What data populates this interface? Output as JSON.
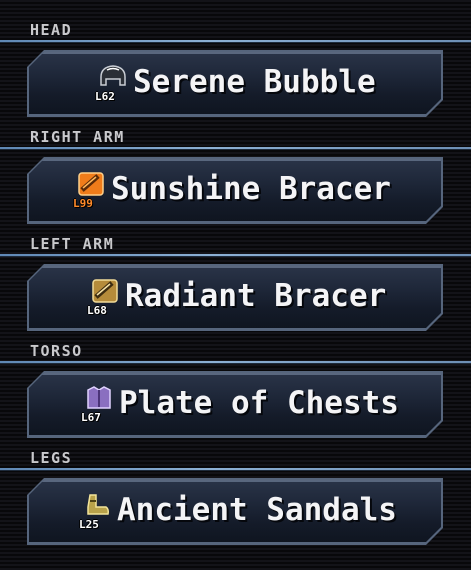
{
  "equipment": {
    "slots": [
      {
        "label": "HEAD",
        "item_name": "Serene Bubble",
        "level": "L62",
        "icon": "helmet-icon"
      },
      {
        "label": "RIGHT ARM",
        "item_name": "Sunshine Bracer",
        "level": "L99",
        "icon": "bracer-icon"
      },
      {
        "label": "LEFT ARM",
        "item_name": "Radiant Bracer",
        "level": "L68",
        "icon": "bracer-icon"
      },
      {
        "label": "TORSO",
        "item_name": "Plate of Chests",
        "level": "L67",
        "icon": "chestplate-icon"
      },
      {
        "label": "LEGS",
        "item_name": "Ancient Sandals",
        "level": "L25",
        "icon": "sandals-icon"
      }
    ]
  },
  "colors": {
    "divider": "#8cb0d4",
    "button_border": "#56657c",
    "button_fill": "#1f283a",
    "max_level": "#ff8a2a"
  }
}
